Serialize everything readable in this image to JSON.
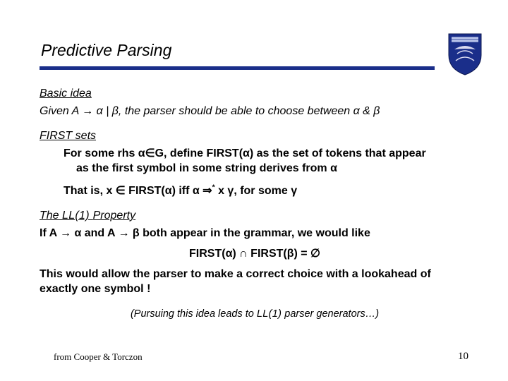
{
  "title": "Predictive Parsing",
  "sections": {
    "basic": {
      "head": "Basic idea",
      "line": "Given A → α | β, the parser should be able to choose between α & β"
    },
    "first": {
      "head": "FIRST sets",
      "line1a": "For some rhs α∈G, define FIRST(α) as the set of tokens that appear",
      "line1b": "as the first symbol in some string derives from α",
      "line2a": "That is, x ∈ FIRST(α) iff  α ⇒",
      "line2_star": "*",
      "line2b": " x γ,  for some γ"
    },
    "ll1": {
      "head_pre": "The ",
      "head_sc": "LL(1) ",
      "head_post": " Property",
      "line1": "If A → α and A → β both appear in the grammar, we would like",
      "eqn": "FIRST(α) ∩ FIRST(β) = ∅",
      "line2": "This would allow the parser to make a correct choice with a lookahead of exactly one symbol !"
    },
    "note_pre": "(Pursuing this idea leads to ",
    "note_sc": "LL(1)",
    "note_post": " parser generators…)"
  },
  "footer": {
    "left": "from Cooper & Torczon",
    "page": "10"
  },
  "shield": {
    "name": "university-shield-icon"
  }
}
